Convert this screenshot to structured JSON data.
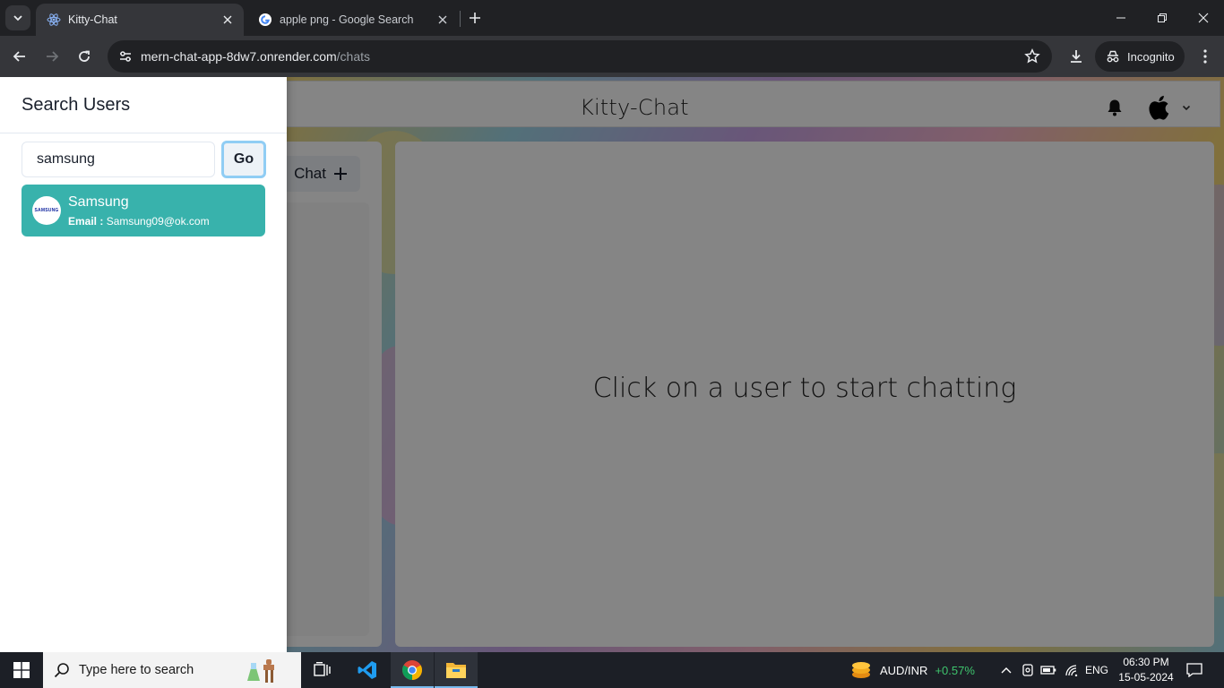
{
  "browser": {
    "tabs": [
      {
        "title": "Kitty-Chat",
        "active": true,
        "favicon": "react-icon"
      },
      {
        "title": "apple png - Google Search",
        "active": false,
        "favicon": "google-icon"
      }
    ],
    "url_host": "mern-chat-app-8dw7.onrender.com",
    "url_path": "/chats",
    "profile_label": "Incognito"
  },
  "app": {
    "title": "Kitty-Chat",
    "new_group_label": "Chat",
    "empty_chat_message": "Click on a user to start chatting",
    "avatar_icon": "apple-logo-icon"
  },
  "search_drawer": {
    "title": "Search Users",
    "query": "samsung",
    "go_label": "Go",
    "results": [
      {
        "name": "Samsung",
        "email_label": "Email :",
        "email": "Samsung09@ok.com",
        "avatar_text": "SAMSUNG"
      }
    ]
  },
  "taskbar": {
    "search_placeholder": "Type here to search",
    "ticker_symbol": "AUD/INR",
    "ticker_change": "+0.57%",
    "language": "ENG",
    "time": "06:30 PM",
    "date": "15-05-2024"
  },
  "colors": {
    "accent_teal": "#38b2ac",
    "focus_ring": "#90cdf4",
    "ticker_positive": "#3ec46d"
  }
}
